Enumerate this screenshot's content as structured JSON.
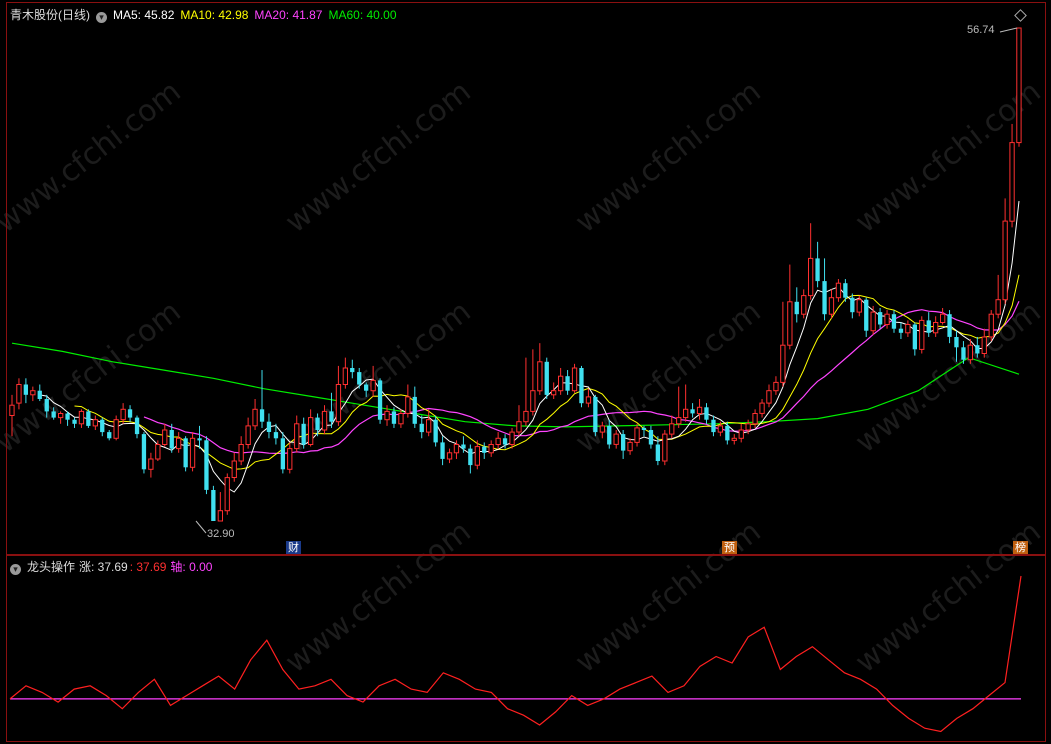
{
  "main_panel": {
    "title": "青木股份(日线)",
    "ma_values": [
      {
        "label": "MA5: 45.82",
        "color": "#ffffff"
      },
      {
        "label": "MA10: 42.98",
        "color": "#ffff00"
      },
      {
        "label": "MA20: 41.87",
        "color": "#ff44ff"
      },
      {
        "label": "MA60: 40.00",
        "color": "#00ee00"
      }
    ],
    "high_label": "56.74",
    "low_label": "32.90",
    "markers": [
      {
        "text": "财",
        "bg": "#1a3a8a",
        "fg": "#ffffff",
        "bar": 38
      },
      {
        "text": "预",
        "bg": "#c06010",
        "fg": "#ffffff",
        "bar": 98
      },
      {
        "text": "榜",
        "bg": "#c06010",
        "fg": "#ffffff",
        "bar": 133
      }
    ]
  },
  "sub_panel": {
    "title": "龙头操作",
    "rise_label": "涨: 37.69",
    "value2": ": 37.69",
    "axis_label": "轴: 0.00"
  },
  "colors": {
    "up": "#ff3030",
    "down": "#40e0f0",
    "frame": "#8a1010",
    "ma5": "#ffffff",
    "ma10": "#ffff00",
    "ma20": "#ff44ff",
    "ma60": "#00ee00",
    "sub_line": "#ff2020",
    "axis_line": "#ff40ff"
  },
  "watermark": "www.cfchi.com",
  "chart_data": {
    "type": "candlestick",
    "ylim": [
      32,
      57.5
    ],
    "candles": [
      [
        38,
        38.5,
        37,
        39
      ],
      [
        38.6,
        39.5,
        38.3,
        39.8
      ],
      [
        39.5,
        39,
        38.6,
        39.8
      ],
      [
        39,
        39.2,
        38.7,
        39.4
      ],
      [
        39.2,
        38.8,
        38.7,
        39.5
      ],
      [
        38.8,
        38.2,
        37.9,
        39
      ],
      [
        38.2,
        37.9,
        37.8,
        38.4
      ],
      [
        37.9,
        38.1,
        37.6,
        38.2
      ],
      [
        38.1,
        37.8,
        37.5,
        38.2
      ],
      [
        37.8,
        37.6,
        37.4,
        37.9
      ],
      [
        37.6,
        38.2,
        37.4,
        38.3
      ],
      [
        38.2,
        37.5,
        37.4,
        38.3
      ],
      [
        37.5,
        37.8,
        37.3,
        38
      ],
      [
        37.8,
        37.2,
        37,
        37.9
      ],
      [
        37.2,
        36.9,
        36.8,
        37.3
      ],
      [
        36.9,
        37.8,
        36.8,
        38
      ],
      [
        37.8,
        38.3,
        37.6,
        38.6
      ],
      [
        38.3,
        37.9,
        37.7,
        38.5
      ],
      [
        37.9,
        37.1,
        36.9,
        38
      ],
      [
        37.1,
        35.4,
        35.2,
        37.2
      ],
      [
        35.4,
        35.9,
        35,
        36.2
      ],
      [
        35.9,
        36.6,
        35.8,
        36.8
      ],
      [
        36.6,
        37.3,
        36.5,
        37.6
      ],
      [
        37.3,
        36.4,
        36.2,
        37.6
      ],
      [
        36.4,
        36.9,
        36.2,
        37.2
      ],
      [
        36.9,
        35.5,
        35.3,
        37
      ],
      [
        35.5,
        36.9,
        35.3,
        37.2
      ],
      [
        36.9,
        36.8,
        36.4,
        37.5
      ],
      [
        36.8,
        34.4,
        34.2,
        37
      ],
      [
        34.4,
        32.9,
        32.9,
        34.6
      ],
      [
        32.9,
        33.4,
        32.9,
        34.3
      ],
      [
        33.4,
        35,
        33.2,
        35.2
      ],
      [
        35,
        35.8,
        34.8,
        36.2
      ],
      [
        35.8,
        36.6,
        35.6,
        37
      ],
      [
        36.6,
        37.5,
        36.4,
        37.9
      ],
      [
        37.5,
        38.3,
        37.3,
        38.8
      ],
      [
        38.3,
        37.7,
        37.4,
        40.2
      ],
      [
        37.7,
        37.2,
        36.9,
        38.1
      ],
      [
        37.2,
        36.9,
        36.6,
        37.6
      ],
      [
        36.9,
        35.4,
        35.2,
        37.2
      ],
      [
        35.4,
        36.4,
        35.2,
        36.7
      ],
      [
        36.4,
        37.6,
        36.2,
        38
      ],
      [
        37.6,
        36.6,
        36.4,
        37.9
      ],
      [
        36.6,
        37.9,
        36.5,
        38.3
      ],
      [
        37.9,
        37.3,
        37,
        38.1
      ],
      [
        37.3,
        38.2,
        37.1,
        38.5
      ],
      [
        38.2,
        37.7,
        37.4,
        39.1
      ],
      [
        37.7,
        39.5,
        37.5,
        40.4
      ],
      [
        39.5,
        40.3,
        39.3,
        40.8
      ],
      [
        40.3,
        40.1,
        39.8,
        40.7
      ],
      [
        40.1,
        39.5,
        39.3,
        40.3
      ],
      [
        39.5,
        39.2,
        38.9,
        39.6
      ],
      [
        39.2,
        39.7,
        38.9,
        40.4
      ],
      [
        39.7,
        37.8,
        37.6,
        39.8
      ],
      [
        37.8,
        38.2,
        37.5,
        38.5
      ],
      [
        38.2,
        37.6,
        37.4,
        38.4
      ],
      [
        37.6,
        38.1,
        37.4,
        38.3
      ],
      [
        38.1,
        38.9,
        37.9,
        39.5
      ],
      [
        38.9,
        37.6,
        37.4,
        39.4
      ],
      [
        37.6,
        37.2,
        36.9,
        38
      ],
      [
        37.2,
        37.8,
        37,
        38.3
      ],
      [
        37.8,
        36.7,
        36.5,
        38
      ],
      [
        36.7,
        35.9,
        35.6,
        37
      ],
      [
        35.9,
        36.2,
        35.7,
        36.4
      ],
      [
        36.2,
        36.6,
        35.9,
        36.8
      ],
      [
        36.6,
        36.4,
        36.2,
        37
      ],
      [
        36.4,
        35.6,
        35.2,
        36.6
      ],
      [
        35.6,
        36.5,
        35.4,
        36.8
      ],
      [
        36.5,
        36.2,
        35.9,
        36.7
      ],
      [
        36.2,
        36.6,
        36,
        36.8
      ],
      [
        36.6,
        36.9,
        36.4,
        37.2
      ],
      [
        36.9,
        36.6,
        36.4,
        37.1
      ],
      [
        36.6,
        37.2,
        36.4,
        37.4
      ],
      [
        37.2,
        37.7,
        37,
        38.5
      ],
      [
        37.7,
        38.2,
        37.5,
        40.8
      ],
      [
        38.2,
        39.2,
        38,
        41.2
      ],
      [
        39.2,
        40.6,
        39,
        41.5
      ],
      [
        40.6,
        39,
        38.8,
        40.8
      ],
      [
        39,
        39.2,
        38.8,
        39.6
      ],
      [
        39.2,
        39.9,
        39,
        40.3
      ],
      [
        39.9,
        39.2,
        39,
        40.2
      ],
      [
        39.2,
        40.3,
        39.1,
        40.5
      ],
      [
        40.3,
        38.6,
        38.4,
        40.4
      ],
      [
        38.6,
        38.9,
        38.4,
        39.3
      ],
      [
        38.9,
        37.2,
        37,
        39
      ],
      [
        37.2,
        37.5,
        36.9,
        37.7
      ],
      [
        37.5,
        36.6,
        36.4,
        37.8
      ],
      [
        36.6,
        37.1,
        36.4,
        37.3
      ],
      [
        37.1,
        36.3,
        35.9,
        37.3
      ],
      [
        36.3,
        36.7,
        36.1,
        36.9
      ],
      [
        36.7,
        37.4,
        36.5,
        37.6
      ],
      [
        37.4,
        37.3,
        37,
        37.5
      ],
      [
        37.3,
        36.6,
        36.4,
        37.5
      ],
      [
        36.6,
        35.8,
        35.6,
        37
      ],
      [
        35.8,
        37.1,
        35.6,
        37.3
      ],
      [
        37.1,
        37.6,
        36.9,
        38
      ],
      [
        37.6,
        37.9,
        37.4,
        39.4
      ],
      [
        37.9,
        38.3,
        37.7,
        39.5
      ],
      [
        38.3,
        38.1,
        37.9,
        38.6
      ],
      [
        38.1,
        38.4,
        37.8,
        38.8
      ],
      [
        38.4,
        37.8,
        37.6,
        38.6
      ],
      [
        37.8,
        37.2,
        37,
        38
      ],
      [
        37.2,
        37.5,
        37,
        37.7
      ],
      [
        37.5,
        36.8,
        36.6,
        37.7
      ],
      [
        36.8,
        36.9,
        36.6,
        37.1
      ],
      [
        36.9,
        37.3,
        36.7,
        37.6
      ],
      [
        37.3,
        37.6,
        37.1,
        37.8
      ],
      [
        37.6,
        38.1,
        37.4,
        38.3
      ],
      [
        38.1,
        38.6,
        37.9,
        38.8
      ],
      [
        38.6,
        39.2,
        38.4,
        39.5
      ],
      [
        39.2,
        39.6,
        39,
        39.9
      ],
      [
        39.6,
        41.4,
        39.4,
        43.5
      ],
      [
        41.4,
        43.5,
        41.2,
        45.3
      ],
      [
        43.5,
        42.9,
        42.5,
        44.2
      ],
      [
        42.9,
        43.8,
        42.7,
        44.1
      ],
      [
        43.8,
        45.6,
        43.6,
        47.3
      ],
      [
        45.6,
        44.5,
        44.2,
        46.4
      ],
      [
        44.5,
        42.9,
        42.6,
        45.6
      ],
      [
        42.9,
        43.7,
        42.7,
        44.1
      ],
      [
        43.7,
        44.4,
        43.5,
        44.6
      ],
      [
        44.4,
        43.7,
        43.5,
        44.6
      ],
      [
        43.7,
        43,
        42.7,
        43.9
      ],
      [
        43,
        43.6,
        42.8,
        43.8
      ],
      [
        43.6,
        42.1,
        41.8,
        43.7
      ],
      [
        42.1,
        43,
        41.9,
        43.3
      ],
      [
        43,
        42.4,
        42.2,
        43.2
      ],
      [
        42.4,
        42.9,
        42.2,
        43.1
      ],
      [
        42.9,
        42.2,
        42,
        43.1
      ],
      [
        42.2,
        42,
        41.7,
        42.5
      ],
      [
        42,
        42.4,
        41.8,
        42.6
      ],
      [
        42.4,
        41.2,
        40.9,
        42.5
      ],
      [
        41.2,
        42.6,
        41,
        42.8
      ],
      [
        42.6,
        42,
        41.8,
        43
      ],
      [
        42,
        42.5,
        41.8,
        42.8
      ],
      [
        42.5,
        42.9,
        42.4,
        43.2
      ],
      [
        42.9,
        41.8,
        41.5,
        43.1
      ],
      [
        41.8,
        41.3,
        40.6,
        42.1
      ],
      [
        41.3,
        40.7,
        40.5,
        41.6
      ],
      [
        40.7,
        41.4,
        40.5,
        41.7
      ],
      [
        41.4,
        41,
        40.8,
        41.8
      ],
      [
        41,
        41.8,
        40.8,
        42.2
      ],
      [
        41.8,
        42.9,
        41.6,
        43.1
      ],
      [
        42.9,
        43.6,
        42.7,
        44.8
      ],
      [
        43.6,
        47.4,
        43.4,
        48.5
      ],
      [
        47.4,
        51.2,
        47.1,
        52.1
      ],
      [
        51.2,
        56.74,
        51,
        56.74
      ]
    ],
    "ma60_points": [
      41.5,
      41.1,
      40.6,
      40.2,
      39.8,
      39.3,
      38.9,
      38.5,
      38.1,
      37.7,
      37.5,
      37.45,
      37.5,
      37.55,
      37.6,
      37.7,
      37.85,
      38.3,
      39.2,
      40.8,
      40
    ],
    "sub_line": [
      0,
      4,
      2,
      -1,
      3,
      4,
      1,
      -3,
      2,
      6,
      -2,
      1,
      4,
      7,
      3,
      12,
      18,
      9,
      3,
      4,
      6,
      1,
      -1,
      4,
      6,
      3,
      2,
      8,
      6,
      3,
      2,
      -3,
      -5,
      -8,
      -4,
      1,
      -2,
      0,
      3,
      5,
      7,
      2,
      4,
      10,
      13,
      11,
      19,
      22,
      9,
      13,
      16,
      12,
      8,
      6,
      3,
      -2,
      -6,
      -9,
      -10,
      -6,
      -3,
      1,
      5,
      37.69
    ]
  }
}
